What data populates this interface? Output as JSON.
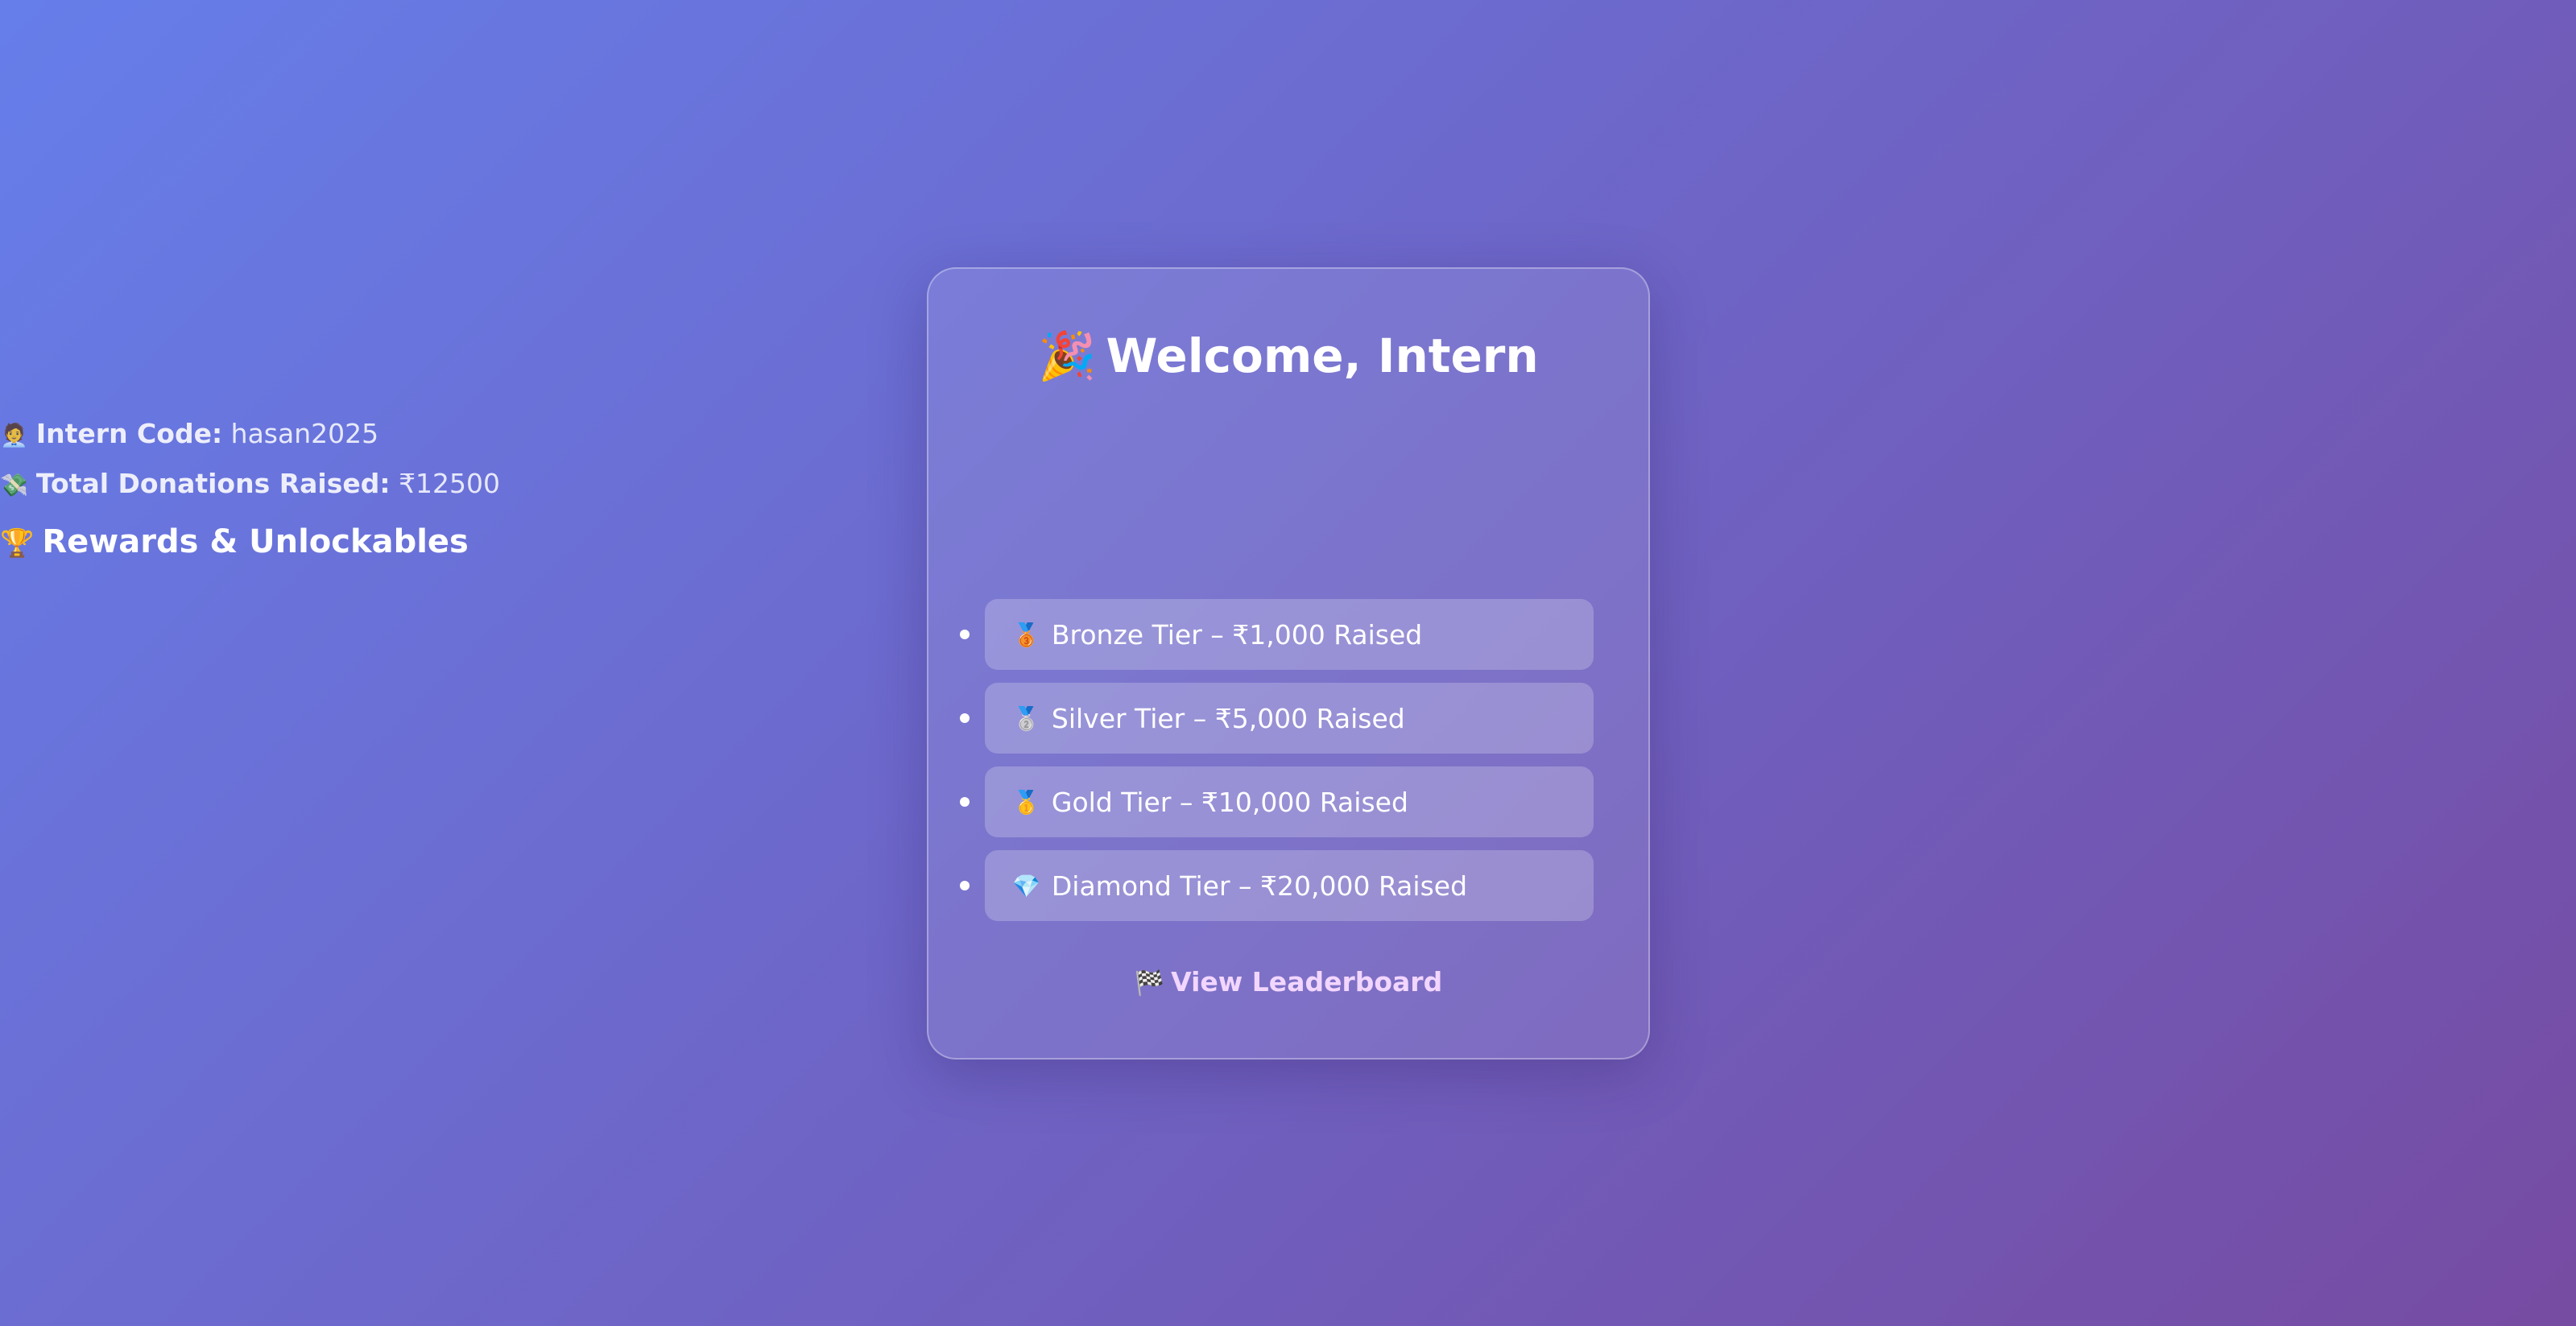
{
  "header": {
    "title_icon": "party-popper-icon",
    "title_emoji": "🎉",
    "title": "Welcome, Intern"
  },
  "intern_info": {
    "code_icon": "person-icon",
    "code_emoji": "🧑‍💼",
    "code_label": "Intern Code:",
    "code_value": "hasan2025",
    "donations_icon": "money-with-wings-icon",
    "donations_emoji": "💸",
    "donations_label": "Total Donations Raised:",
    "donations_value": "₹12500"
  },
  "rewards": {
    "heading_icon": "trophy-icon",
    "heading_emoji": "🏆",
    "heading": "Rewards & Unlockables",
    "tiers": [
      {
        "icon": "bronze-medal-icon",
        "emoji": "🥉",
        "label": "Bronze Tier – ₹1,000 Raised"
      },
      {
        "icon": "silver-medal-icon",
        "emoji": "🥈",
        "label": "Silver Tier – ₹5,000 Raised"
      },
      {
        "icon": "gold-medal-icon",
        "emoji": "🥇",
        "label": "Gold Tier – ₹10,000 Raised"
      },
      {
        "icon": "gem-icon",
        "emoji": "💎",
        "label": "Diamond Tier – ₹20,000 Raised"
      }
    ]
  },
  "leaderboard_link": {
    "icon": "checkered-flag-icon",
    "emoji": "🏁",
    "label": "View Leaderboard"
  },
  "colors": {
    "background_start": "#667eea",
    "background_end": "#764ba2",
    "link": "#f2d6ff"
  }
}
